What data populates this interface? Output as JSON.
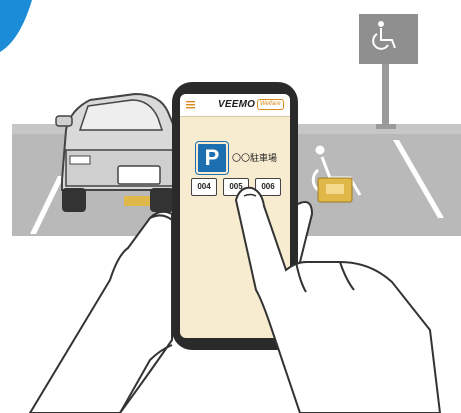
{
  "app": {
    "brand": "VEEMO",
    "badge": "Welfare"
  },
  "screen": {
    "parking_lot_name": "〇〇駐車場",
    "parking_icon_letter": "P",
    "slots": [
      "004",
      "005",
      "006"
    ]
  },
  "scene": {
    "sign_icon": "wheelchair-icon",
    "menu_icon": "hamburger-menu-icon",
    "colors": {
      "accent_blue": "#1d6fb0",
      "app_orange": "#d98a1d",
      "screen_bg": "#f7ecd0",
      "stopper_yellow": "#e0b84a"
    }
  }
}
